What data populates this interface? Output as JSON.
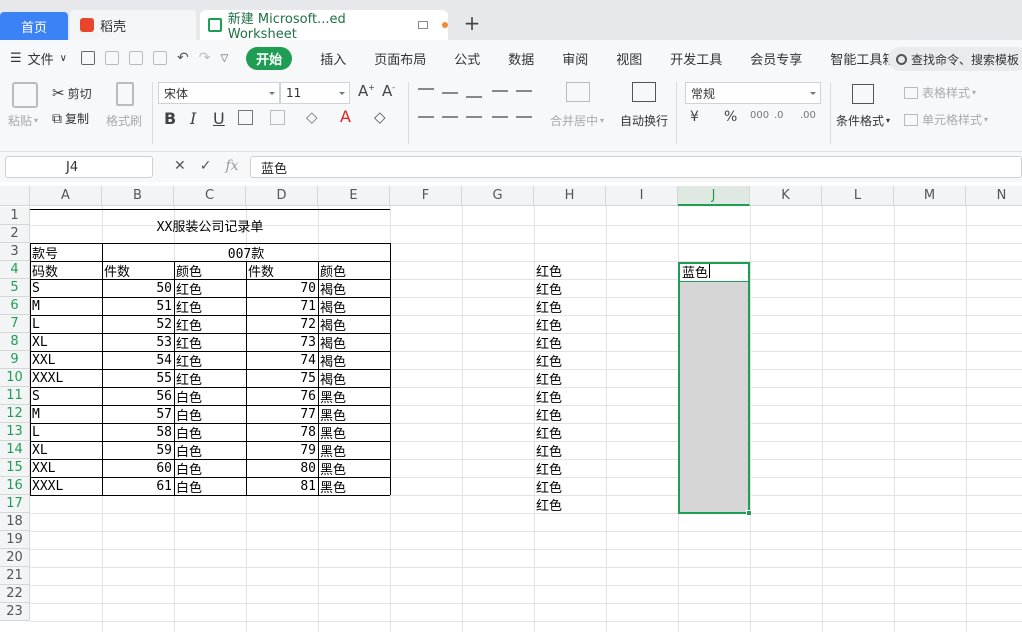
{
  "tabs": {
    "home": "首页",
    "docer": "稻壳",
    "sheet": "新建 Microsoft...ed Worksheet",
    "add": "+"
  },
  "menu": {
    "file": "文件",
    "items": [
      "开始",
      "插入",
      "页面布局",
      "公式",
      "数据",
      "审阅",
      "视图",
      "开发工具",
      "会员专享",
      "智能工具箱"
    ],
    "search": "查找命令、搜索模板"
  },
  "ribbon": {
    "paste": "粘贴",
    "cut": "剪切",
    "copy": "复制",
    "format_painter": "格式刷",
    "font_name": "宋体",
    "font_size": "11",
    "bold": "B",
    "italic": "I",
    "underline": "U",
    "grow": "A",
    "shrink": "A",
    "merge": "合并居中",
    "wrap": "自动换行",
    "number_format": "常规",
    "currency": "¥",
    "percent": "%",
    "table_style": "表格样式",
    "cond_format": "条件格式",
    "cell_style": "单元格样式"
  },
  "formula": {
    "cell_ref": "J4",
    "content": "蓝色",
    "fx": "fx"
  },
  "columns": [
    "A",
    "B",
    "C",
    "D",
    "E",
    "F",
    "G",
    "H",
    "I",
    "J",
    "K",
    "L",
    "M",
    "N"
  ],
  "rows": [
    "1",
    "2",
    "3",
    "4",
    "5",
    "6",
    "7",
    "8",
    "9",
    "10",
    "11",
    "12",
    "13",
    "14",
    "15",
    "16",
    "17",
    "18",
    "19",
    "20",
    "21",
    "22",
    "23"
  ],
  "sheet": {
    "title": "XX服装公司记录单",
    "header_row3": {
      "a": "款号",
      "bd": "007款"
    },
    "header_row4": [
      "码数",
      "件数",
      "颜色",
      "件数",
      "颜色"
    ],
    "rows": [
      [
        "S",
        "50",
        "红色",
        "70",
        "褐色"
      ],
      [
        "M",
        "51",
        "红色",
        "71",
        "褐色"
      ],
      [
        "L",
        "52",
        "红色",
        "72",
        "褐色"
      ],
      [
        "XL",
        "53",
        "红色",
        "73",
        "褐色"
      ],
      [
        "XXL",
        "54",
        "红色",
        "74",
        "褐色"
      ],
      [
        "XXXL",
        "55",
        "红色",
        "75",
        "褐色"
      ],
      [
        "S",
        "56",
        "白色",
        "76",
        "黑色"
      ],
      [
        "M",
        "57",
        "白色",
        "77",
        "黑色"
      ],
      [
        "L",
        "58",
        "白色",
        "78",
        "黑色"
      ],
      [
        "XL",
        "59",
        "白色",
        "79",
        "黑色"
      ],
      [
        "XXL",
        "60",
        "白色",
        "80",
        "黑色"
      ],
      [
        "XXXL",
        "61",
        "白色",
        "81",
        "黑色"
      ]
    ],
    "h_column": [
      "红色",
      "红色",
      "红色",
      "红色",
      "红色",
      "红色",
      "红色",
      "红色",
      "红色",
      "红色",
      "红色",
      "红色",
      "红色",
      "红色"
    ],
    "j4": "蓝色"
  }
}
